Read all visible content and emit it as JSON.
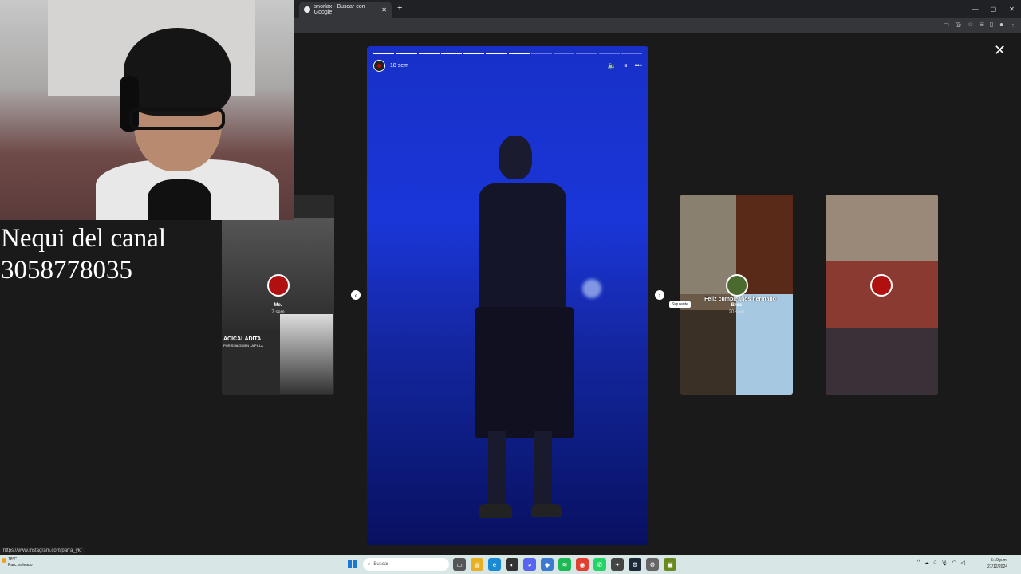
{
  "browser": {
    "tab_title": "snorlax - Buscar con Google",
    "tab_close": "✕",
    "new_tab": "+",
    "window_controls": [
      "—",
      "▢",
      "✕"
    ]
  },
  "viewer": {
    "close_label": "✕",
    "story": {
      "progress_total": 12,
      "progress_done": 7,
      "time": "18 sem",
      "controls": [
        "🔈",
        "⏸",
        "•••"
      ]
    },
    "prev_arrow": "‹",
    "next_arrow": "›",
    "next_tooltip": "Siguiente",
    "cards": [
      {
        "name": "Me.",
        "time": "7 sem",
        "caption": "ACICALADITA",
        "subcaption": "POR SI ALGUIEN LA PILLA"
      },
      {
        "name": "Bros",
        "time": "20 sem",
        "caption": "Feliz cumpleaños hermano"
      },
      {
        "name": "",
        "time": "",
        "caption": ""
      }
    ]
  },
  "overlay": {
    "nequi_line1": "Nequi del canal",
    "nequi_line2": "3058778035"
  },
  "status_url": "https://www.instagram.com/parra_yk/",
  "taskbar": {
    "weather_temp": "18°C",
    "weather_desc": "Parc. soleado",
    "search_placeholder": "Buscar",
    "time": "5:10 p.m.",
    "date": "27/12/2024"
  },
  "colors": {
    "story_blue": "#1a36d8",
    "viewer_bg": "#1a1a1a",
    "taskbar_bg": "#d8e7e5"
  }
}
